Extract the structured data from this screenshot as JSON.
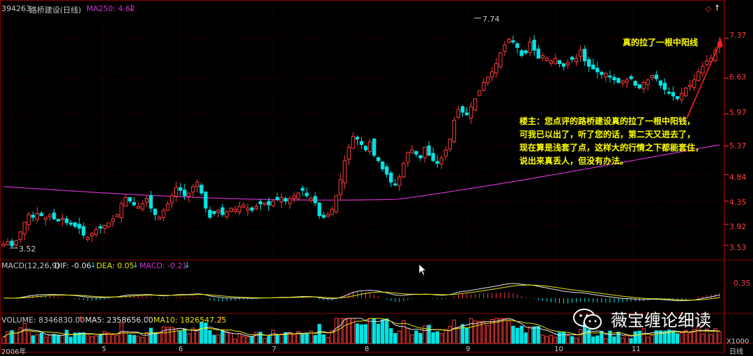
{
  "header": {
    "code": "394263",
    "name": "路桥建设(日线)",
    "ma250": "MA250: 4.62"
  },
  "price_axis": {
    "ticks": [
      "7.37",
      "6.63",
      "5.97",
      "5.37",
      "4.84",
      "4.35",
      "3.92",
      "3.53"
    ]
  },
  "markers": {
    "high": "7.74",
    "low": "3.52"
  },
  "macd_header": {
    "name": "MACD(12,26,9)",
    "dif": "DIF: -0.06",
    "dea": "DEA: 0.05",
    "macd": "MACD: -0.21"
  },
  "macd_axis": {
    "ticks": [
      "0.35"
    ]
  },
  "volume_header": {
    "volume": "VOLUME: 8346830.00",
    "ma5": "MA5: 2358656.00",
    "ma10": "MA10: 1826547.25"
  },
  "volume_axis": {
    "unit": "X1000"
  },
  "x_labels": [
    "2006年",
    "5",
    "6",
    "7",
    "8",
    "9",
    "10",
    "11",
    "日线"
  ],
  "annotation": {
    "title": "真的拉了一根中阳线",
    "lines": [
      "楼主：您点评的路桥建设真的拉了一根中阳钱，",
      "可我已以出了，听了您的话，第二天又进去了，",
      "现在算是浅套了点，这样大的行情之下都能套住，",
      "说出来真丢人，但没有办法。"
    ]
  },
  "watermark": "薇宝缠论细读",
  "colors": {
    "up": "#ff3c3c",
    "down": "#00e4e4",
    "ma250": "#cc33cc",
    "dif": "#e6e6e6",
    "dea": "#e6e600",
    "annotation": "#ffff00",
    "grid": "#8b0000"
  },
  "chart_data": {
    "type": "candlestick",
    "title": "路桥建设(日线)",
    "ylim": [
      3.3,
      7.9
    ],
    "price_ticks": [
      7.37,
      6.63,
      5.97,
      5.37,
      4.84,
      4.35,
      3.92,
      3.53
    ],
    "period_labels": [
      "2006年",
      "5",
      "6",
      "7",
      "8",
      "9",
      "10",
      "11"
    ],
    "close": [
      3.55,
      3.6,
      3.52,
      3.62,
      3.78,
      3.96,
      4.1,
      4.05,
      4.12,
      4.08,
      4.05,
      4.1,
      4.02,
      3.98,
      4.03,
      3.95,
      3.92,
      3.88,
      3.85,
      3.72,
      3.68,
      3.75,
      3.82,
      3.85,
      3.9,
      3.95,
      4.02,
      4.1,
      4.3,
      4.42,
      4.35,
      4.28,
      4.25,
      4.3,
      4.4,
      4.22,
      4.1,
      4.05,
      4.18,
      4.3,
      4.45,
      4.6,
      4.55,
      4.45,
      4.5,
      4.62,
      4.7,
      4.5,
      4.22,
      4.05,
      4.12,
      4.18,
      4.1,
      4.15,
      4.22,
      4.2,
      4.25,
      4.28,
      4.22,
      4.18,
      4.25,
      4.3,
      4.32,
      4.28,
      4.35,
      4.38,
      4.42,
      4.35,
      4.4,
      4.45,
      4.5,
      4.55,
      4.45,
      4.4,
      4.32,
      4.08,
      4.05,
      4.1,
      4.2,
      4.45,
      4.75,
      5.1,
      5.35,
      5.55,
      5.5,
      5.4,
      5.3,
      5.45,
      5.2,
      5.1,
      4.95,
      4.85,
      4.7,
      4.65,
      4.8,
      5.05,
      5.25,
      5.3,
      5.22,
      5.15,
      5.35,
      5.2,
      5.1,
      5.05,
      5.15,
      5.3,
      5.5,
      5.85,
      6.05,
      6.0,
      5.95,
      6.1,
      6.25,
      6.4,
      6.55,
      6.65,
      6.75,
      6.9,
      7.1,
      7.25,
      7.35,
      7.3,
      7.2,
      7.05,
      7.1,
      7.3,
      7.15,
      7.0,
      7.05,
      7.0,
      6.95,
      7.0,
      6.9,
      6.85,
      6.92,
      6.98,
      7.0,
      7.15,
      6.95,
      6.85,
      6.8,
      6.75,
      6.7,
      6.72,
      6.65,
      6.6,
      6.55,
      6.58,
      6.6,
      6.62,
      6.5,
      6.45,
      6.55,
      6.6,
      6.68,
      6.62,
      6.5,
      6.42,
      6.35,
      6.3,
      6.25,
      6.35,
      6.45,
      6.5,
      6.6,
      6.75,
      6.85,
      6.95,
      7.0,
      7.15,
      7.3
    ],
    "high_marker": 7.74,
    "low_marker": 3.52,
    "ma250_value": 4.62
  }
}
